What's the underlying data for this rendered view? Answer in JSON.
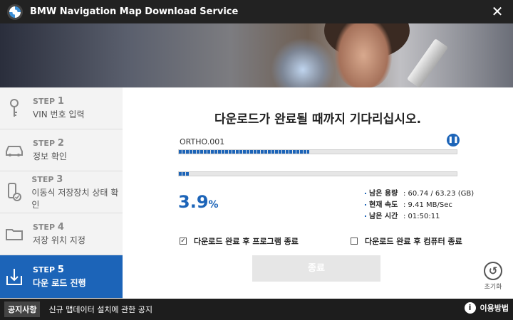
{
  "window": {
    "title": "BMW Navigation Map Download Service",
    "close_glyph": "✕"
  },
  "sidebar": {
    "steps": [
      {
        "prefix": "STEP",
        "num": "1",
        "label": "VIN 번호 입력",
        "icon": "key-icon"
      },
      {
        "prefix": "STEP",
        "num": "2",
        "label": "정보 확인",
        "icon": "car-icon"
      },
      {
        "prefix": "STEP",
        "num": "3",
        "label": "이동식 저장장치 상태 확인",
        "icon": "usb-check-icon"
      },
      {
        "prefix": "STEP",
        "num": "4",
        "label": "저장 위치 지정",
        "icon": "folder-icon"
      },
      {
        "prefix": "STEP",
        "num": "5",
        "label": "다운 로드 진행",
        "icon": "download-icon"
      }
    ],
    "active_step": 5
  },
  "main": {
    "heading": "다운로드가 완료될 때까지 기다리십시오.",
    "file_name": "ORTHO.001",
    "file_progress": 0.47,
    "total_progress": 0.039,
    "percent_value": "3.9",
    "percent_unit": "%",
    "stats": [
      {
        "label": "남은 용량",
        "value": ": 60.74 / 63.23 (GB)"
      },
      {
        "label": "현재 속도",
        "value": ": 9.41 MB/Sec"
      },
      {
        "label": "남은 시간",
        "value": ": 01:50:11"
      }
    ],
    "options": {
      "close_program": {
        "label": "다운로드 완료 후 프로그램 종료",
        "checked": true
      },
      "shutdown_pc": {
        "label": "다운로드 완료 후 컴퓨터 종료",
        "checked": false
      }
    },
    "end_button": "종료",
    "reset_label": "초기화"
  },
  "footer": {
    "notice_badge": "공지사항",
    "notice_text": "신규 맵데이터 설치에 관한 공지",
    "help_label": "이용방법"
  },
  "colors": {
    "accent": "#1c64b8",
    "titlebar": "#222222",
    "footer": "#1d1d1d"
  }
}
